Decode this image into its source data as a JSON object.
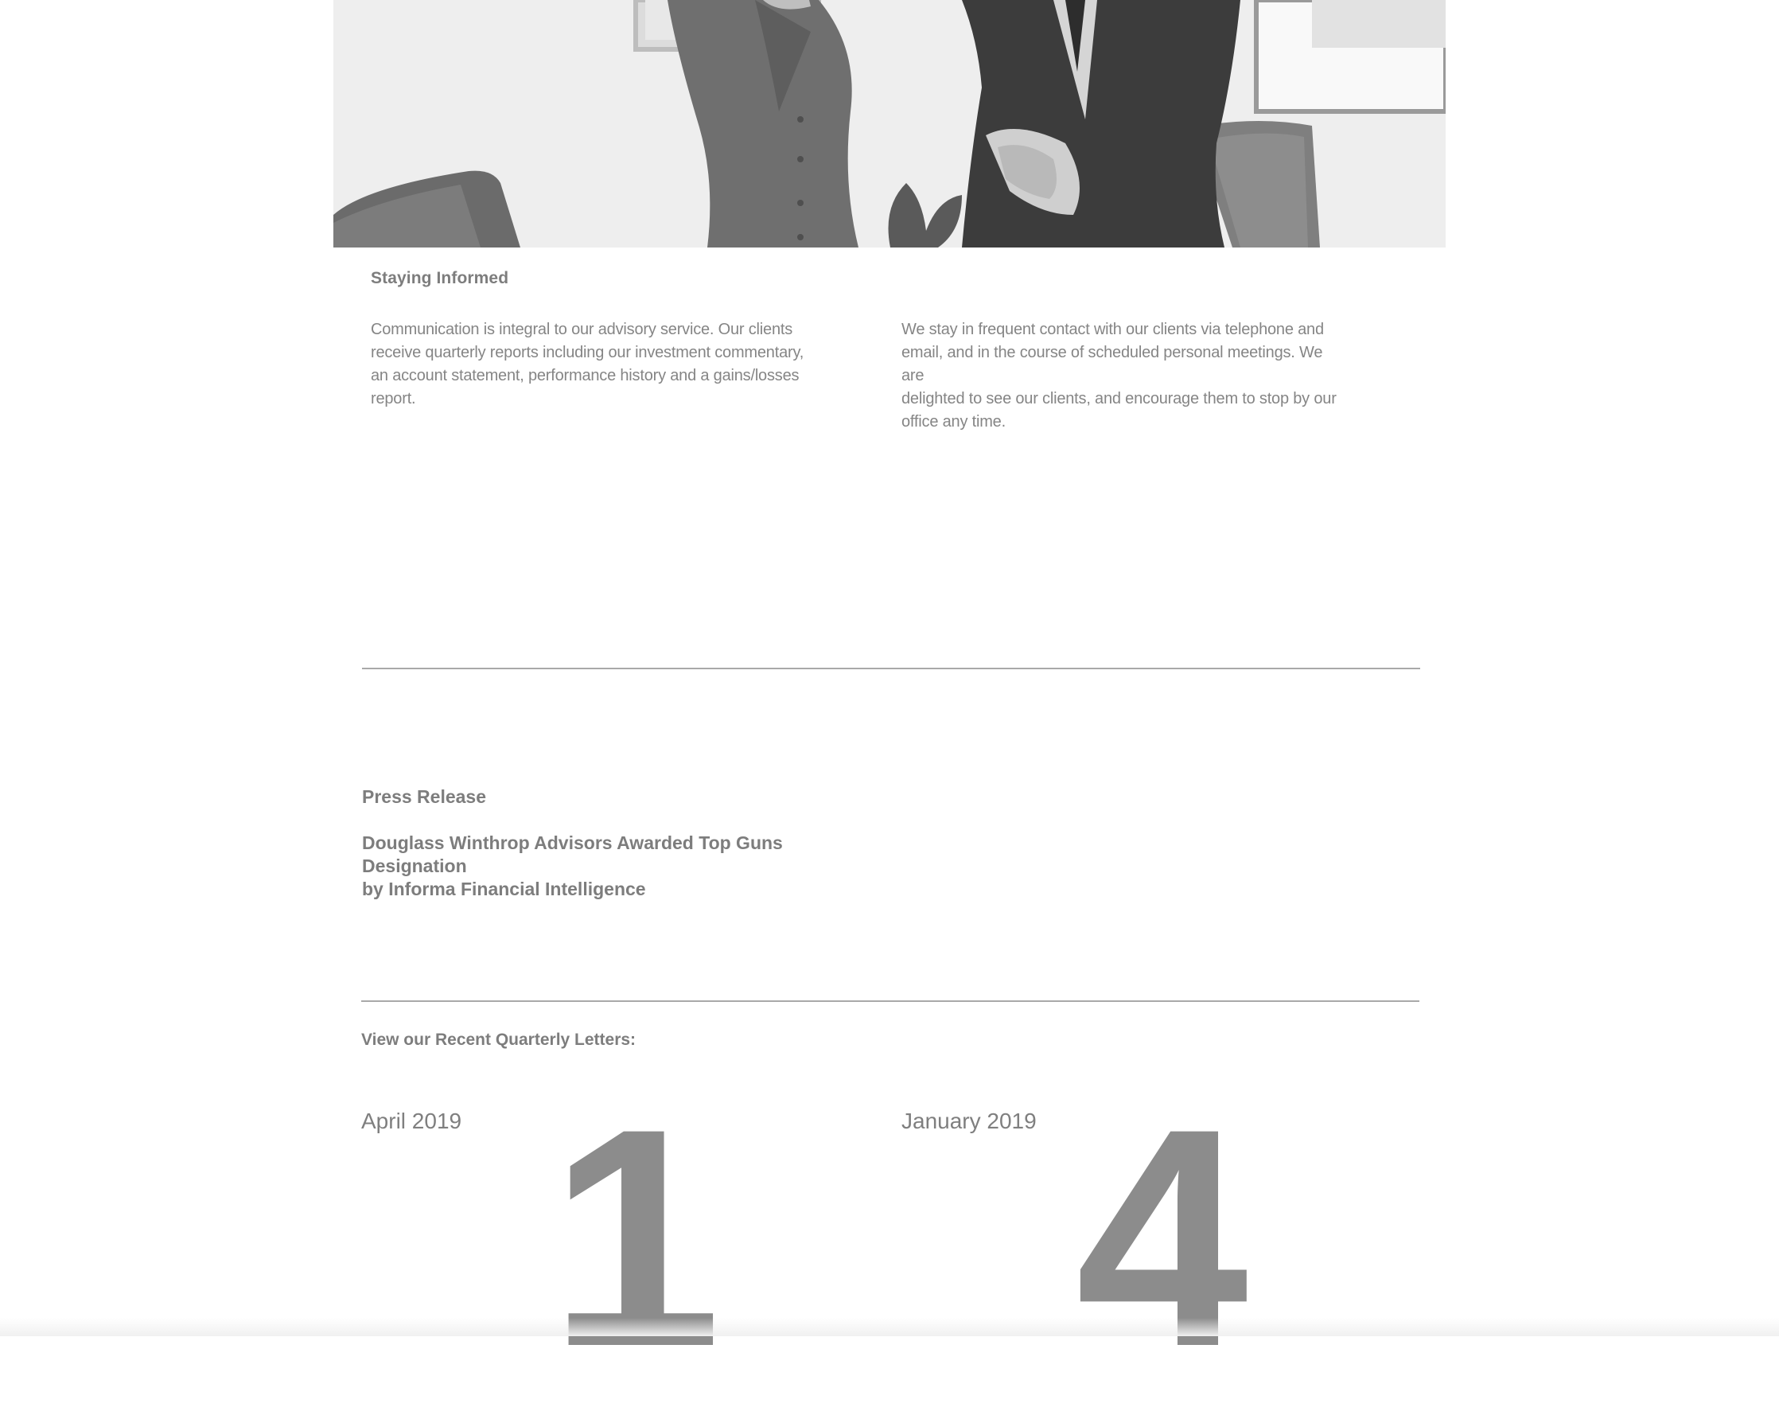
{
  "hero": {
    "image_description_icon": "photo-icon"
  },
  "staying_informed": {
    "heading": "Staying Informed",
    "left_paragraph_lines": [
      "Communication is integral to our advisory service. Our clients",
      "receive quarterly reports including our investment commentary,",
      "an account statement, performance history and a gains/losses",
      "report."
    ],
    "right_paragraph_lines": [
      "We stay in frequent contact with our clients via telephone and",
      "email, and in the course of scheduled personal meetings. We are",
      "delighted to see our clients, and encourage them to stop by our",
      "office any time."
    ]
  },
  "press": {
    "label": "Press Release",
    "title_line1": "Douglass Winthrop Advisors Awarded Top Guns Designation",
    "title_line2": "by Informa Financial Intelligence"
  },
  "letters": {
    "title": "View our Recent Quarterly Letters:",
    "items": [
      {
        "month": "April 2019",
        "quarter_numeral": "1"
      },
      {
        "month": "January 2019",
        "quarter_numeral": "4"
      }
    ]
  }
}
